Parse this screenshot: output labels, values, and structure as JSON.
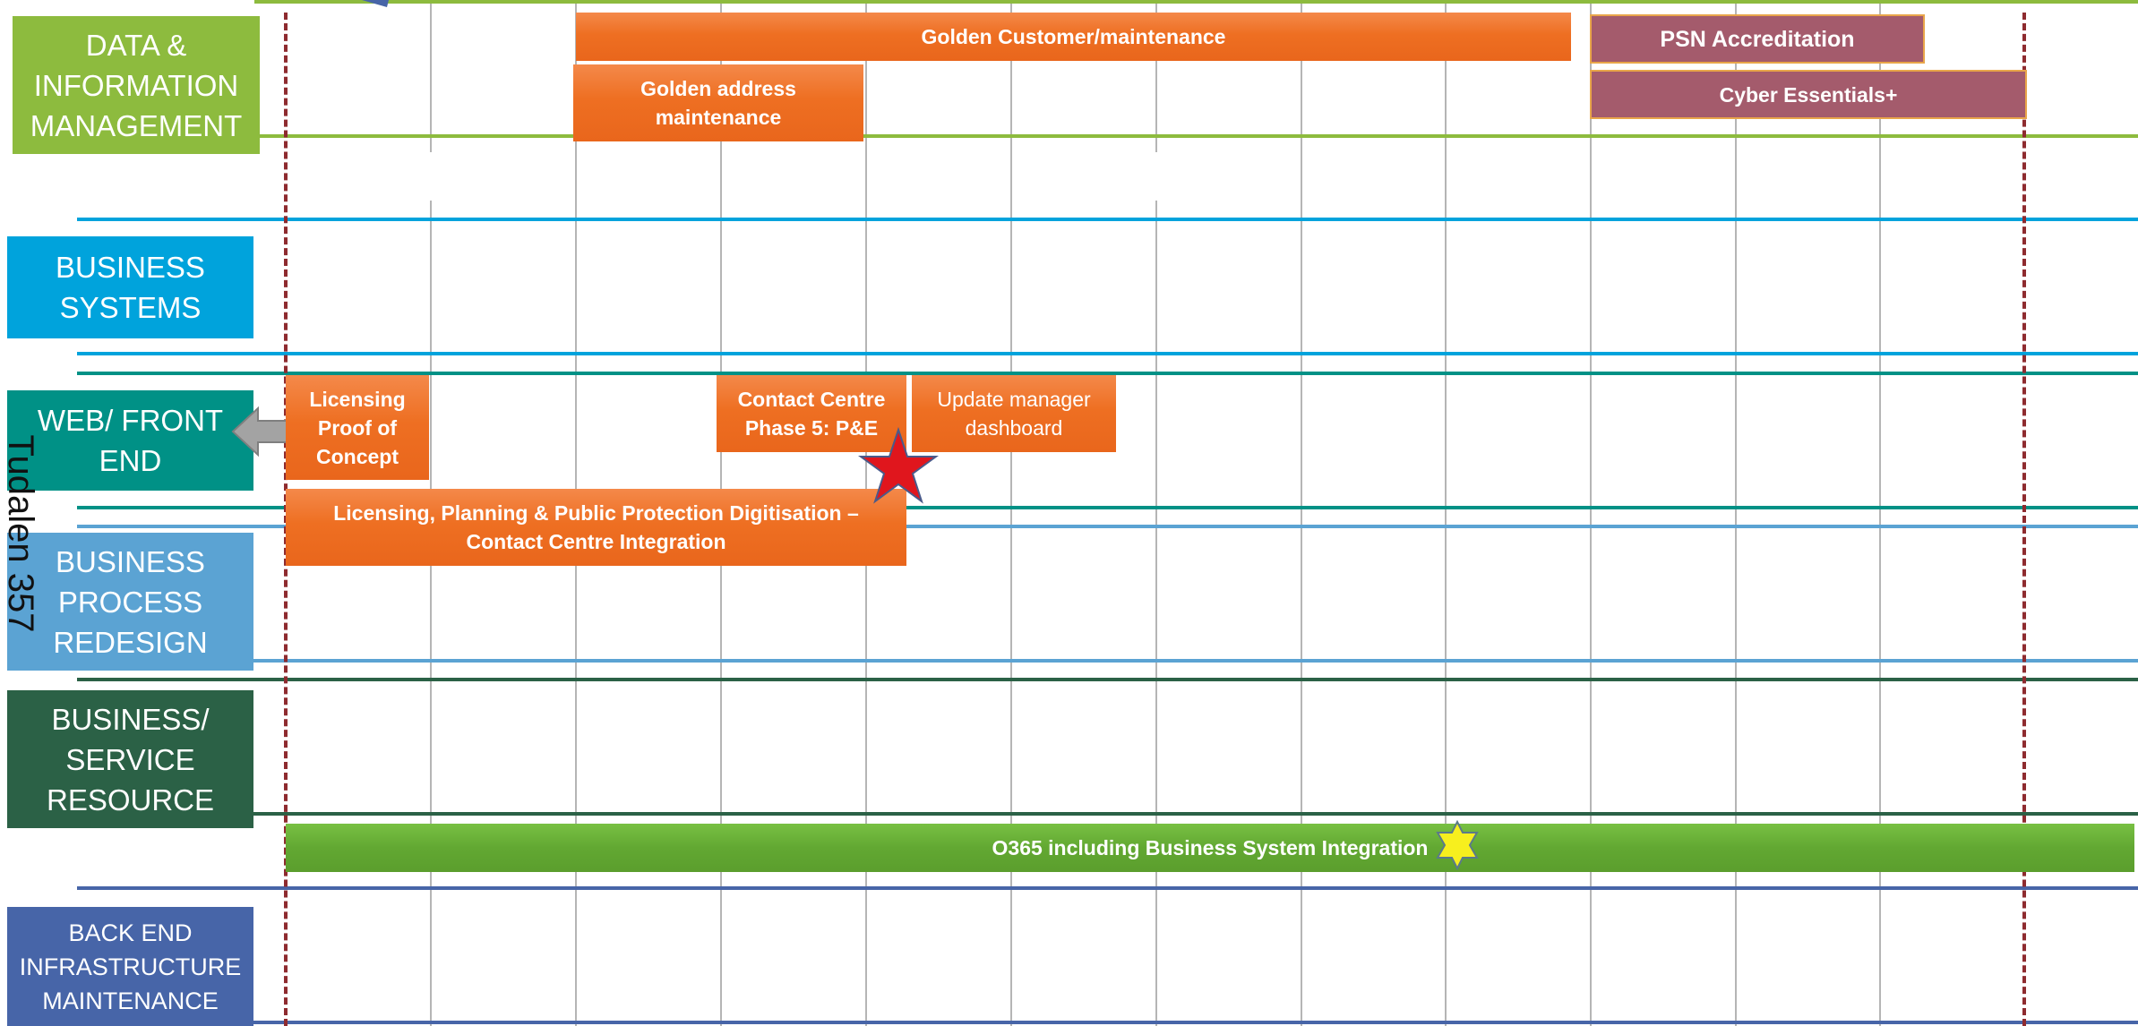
{
  "lanes": {
    "data_info": "DATA &\nINFORMATION\nMANAGEMENT",
    "business_systems": "BUSINESS\nSYSTEMS",
    "web_front_end": "WEB/ FRONT\nEND",
    "business_process": "BUSINESS\nPROCESS\nREDESIGN",
    "business_service": "BUSINESS/\nSERVICE\nRESOURCE",
    "back_end": "BACK END\nINFRASTRUCTURE\nMAINTENANCE"
  },
  "vertical_label": "Tudalen 357",
  "projects": {
    "golden_customer": "Golden Customer/maintenance",
    "psn": "PSN Accreditation",
    "golden_address": "Golden address\nmaintenance",
    "cyber": "Cyber Essentials+",
    "licensing_poc": "Licensing\nProof of\nConcept",
    "contact_centre": "Contact Centre\nPhase 5: P&E",
    "update_manager": "Update manager\ndashboard",
    "licensing_digitisation": "Licensing, Planning & Public Protection Digitisation –\nContact Centre Integration",
    "o365": "O365 including Business System Integration"
  },
  "icons": {
    "milestone_red": "red-star-icon",
    "milestone_yellow": "yellow-star-icon",
    "arrow": "left-arrow-icon"
  },
  "colors": {
    "data_info": "#8dbb3e",
    "business_systems": "#00a3dc",
    "web_front_end": "#009186",
    "business_process": "#5ba3d3",
    "business_service": "#2b6146",
    "back_end": "#4765a8",
    "orange": "#ee6f22",
    "plum": "#a45b6c",
    "green": "#62a832",
    "boundary": "#8e2b2f"
  }
}
